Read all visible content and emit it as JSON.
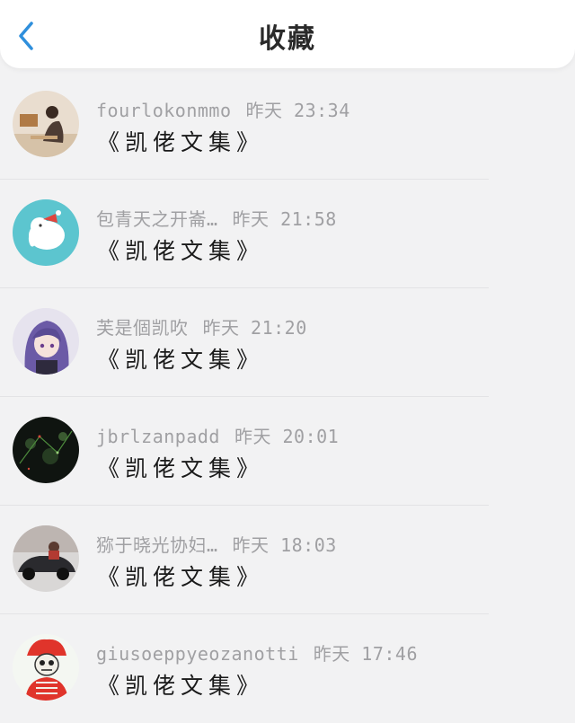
{
  "header": {
    "title": "收藏"
  },
  "items": [
    {
      "user": "fourlokonmmo",
      "time": "昨天 23:34",
      "content": "《凯佬文集》"
    },
    {
      "user": "包青天之开崙…",
      "time": "昨天 21:58",
      "content": "《凯佬文集》"
    },
    {
      "user": "芙是個凯吹",
      "time": "昨天 21:20",
      "content": "《凯佬文集》"
    },
    {
      "user": "jbrlzanpadd",
      "time": "昨天 20:01",
      "content": "《凯佬文集》"
    },
    {
      "user": "猕于晓光协妇…",
      "time": "昨天 18:03",
      "content": "《凯佬文集》"
    },
    {
      "user": "giusoeppyeozanotti",
      "time": "昨天 17:46",
      "content": "《凯佬文集》"
    }
  ],
  "colors": {
    "accent": "#2f8fdc",
    "background": "#f2f2f3",
    "meta_text": "#a0a0a3"
  },
  "icons": {
    "back": "chevron-left-icon"
  }
}
